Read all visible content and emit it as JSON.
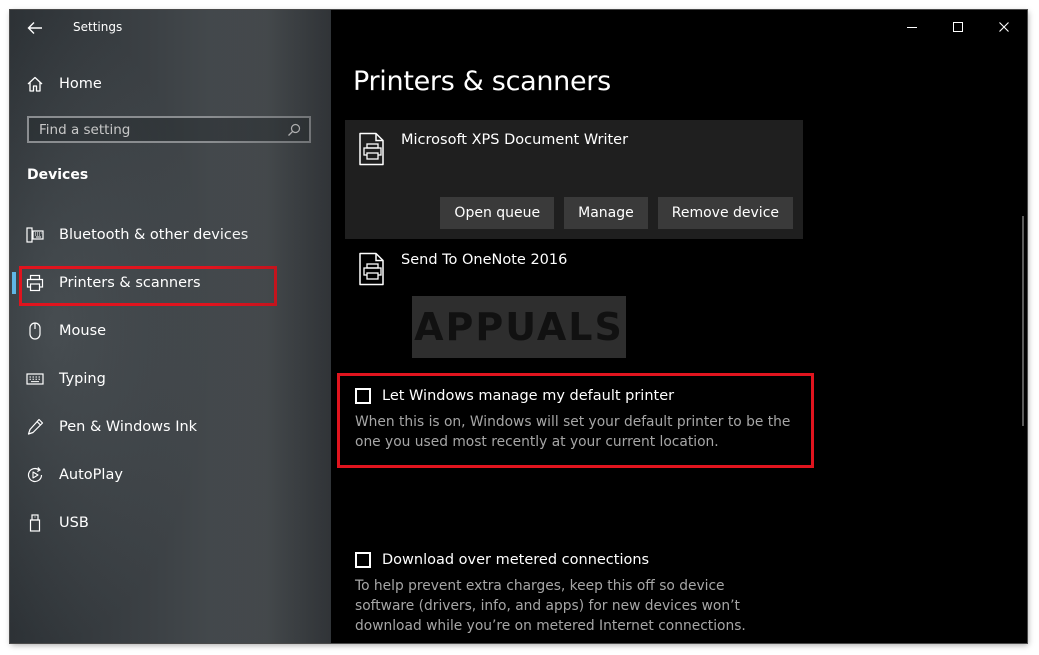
{
  "window": {
    "title": "Settings"
  },
  "sidebar": {
    "home_label": "Home",
    "search_placeholder": "Find a setting",
    "section_heading": "Devices",
    "items": [
      {
        "label": "Bluetooth & other devices",
        "icon": "bluetooth-devices-icon"
      },
      {
        "label": "Printers & scanners",
        "icon": "printer-icon",
        "selected": true
      },
      {
        "label": "Mouse",
        "icon": "mouse-icon"
      },
      {
        "label": "Typing",
        "icon": "keyboard-icon"
      },
      {
        "label": "Pen & Windows Ink",
        "icon": "pen-icon"
      },
      {
        "label": "AutoPlay",
        "icon": "autoplay-icon"
      },
      {
        "label": "USB",
        "icon": "usb-icon"
      }
    ]
  },
  "main": {
    "page_title": "Printers & scanners",
    "printers": [
      {
        "name": "Microsoft XPS Document Writer",
        "expanded": true,
        "buttons": [
          "Open queue",
          "Manage",
          "Remove device"
        ]
      },
      {
        "name": "Send To OneNote 2016",
        "expanded": false
      }
    ],
    "settings": [
      {
        "label": "Let Windows manage my default printer",
        "checked": false,
        "description": "When this is on, Windows will set your default printer to be the one you used most recently at your current location."
      },
      {
        "label": "Download over metered connections",
        "checked": false,
        "description": "To help prevent extra charges, keep this off so device software (drivers, info, and apps) for new devices won’t download while you’re on metered Internet connections."
      }
    ]
  },
  "watermark": {
    "text": "APPUALS"
  },
  "colors": {
    "highlight_border": "#e0141e",
    "selection_accent": "#5fb6e6",
    "card_background": "#1f1f1f",
    "button_background": "#3a3a3a"
  }
}
